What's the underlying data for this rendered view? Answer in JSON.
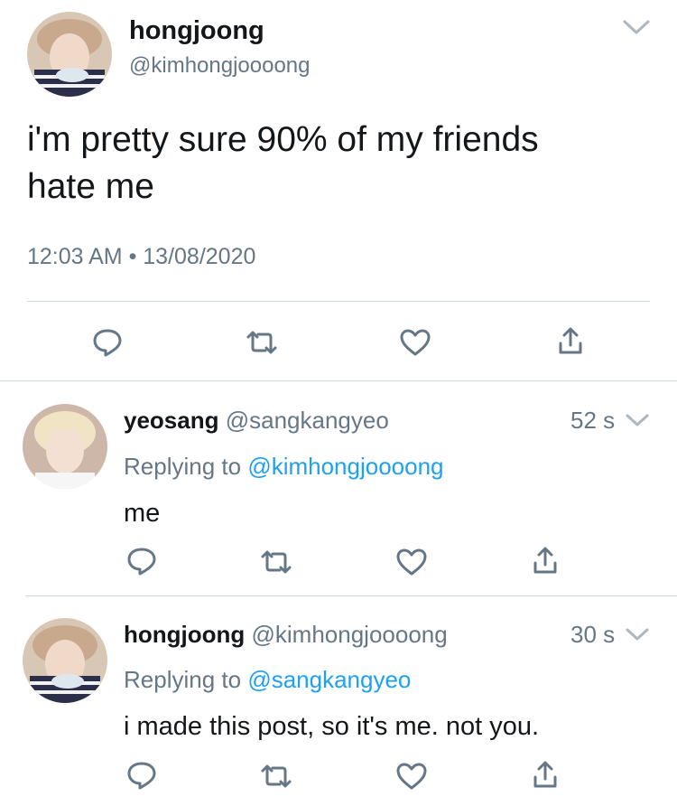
{
  "main_tweet": {
    "author_name": "hongjoong",
    "author_handle": "@kimhongjoooong",
    "text_line1": "i'm pretty sure 90% of my friends",
    "text_line2": "hate me",
    "timestamp": "12:03 AM • 13/08/2020",
    "actions": [
      "reply-icon",
      "retweet-icon",
      "like-icon",
      "share-icon"
    ]
  },
  "replies": [
    {
      "author_name": "yeosang",
      "author_handle": "@sangkangyeo",
      "time_ago": "52 s",
      "replying_prefix": "Replying to",
      "replying_to": "@kimhongjoooong",
      "text": "me"
    },
    {
      "author_name": "hongjoong",
      "author_handle": "@kimhongjoooong",
      "time_ago": "30 s",
      "replying_prefix": "Replying to",
      "replying_to": "@sangkangyeo",
      "text": "i made this post, so it's me. not you."
    }
  ],
  "colors": {
    "text": "#14171a",
    "muted": "#657786",
    "link": "#1da1f2",
    "divider": "#cfd6dc"
  }
}
